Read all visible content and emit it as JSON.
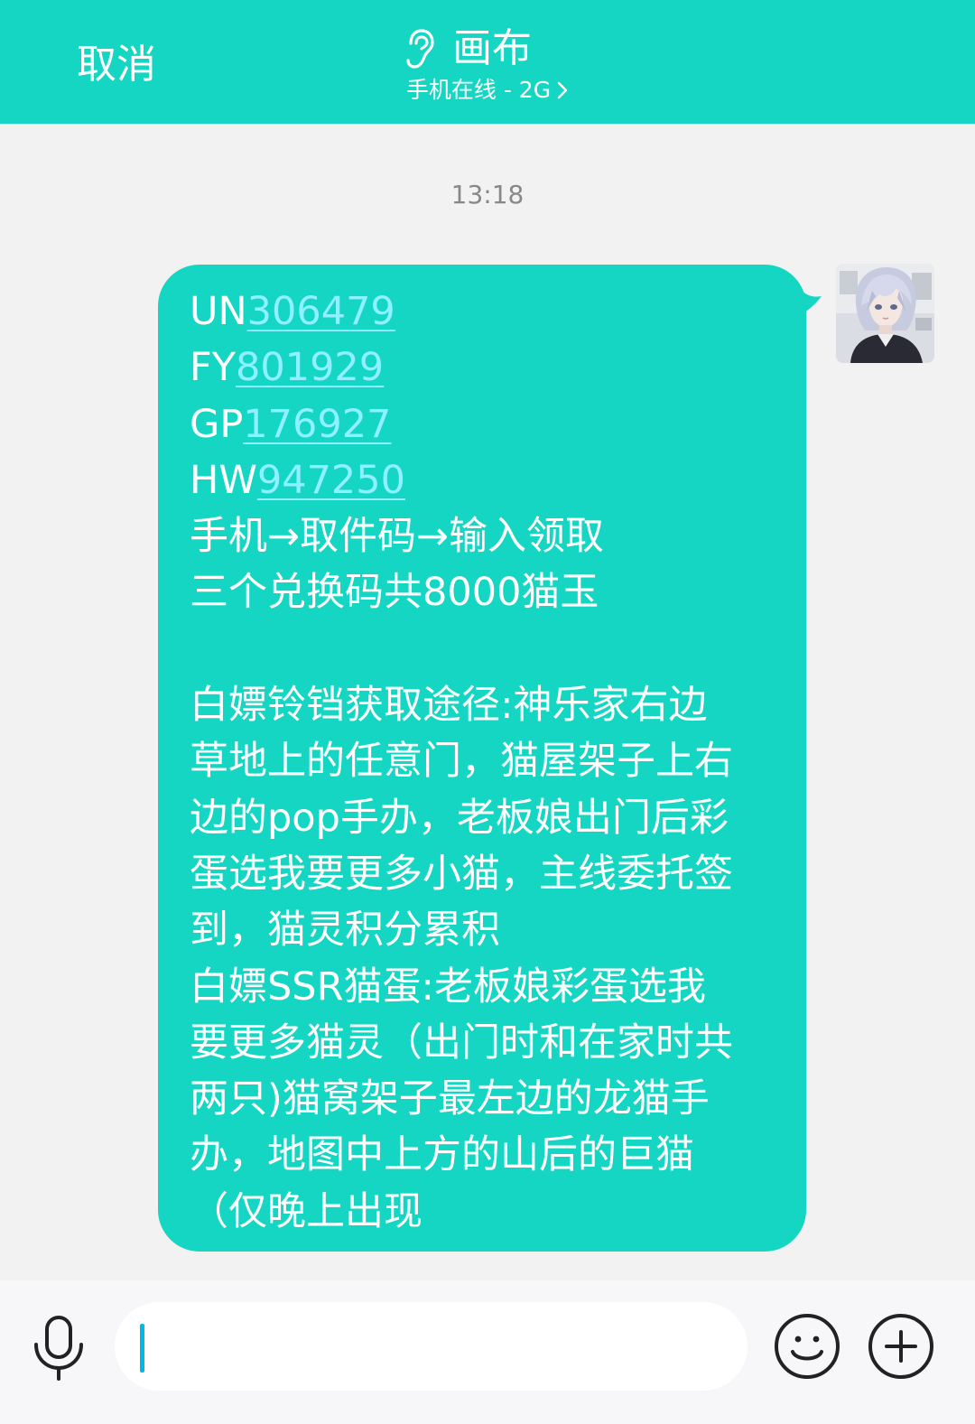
{
  "header": {
    "cancel_label": "取消",
    "title": "画布",
    "subtitle": "手机在线 - 2G",
    "ear_icon": "ear-icon",
    "chevron_icon": "chevron-right-icon",
    "background_color": "#14d6c3"
  },
  "chat": {
    "timestamp": "13:18",
    "message": {
      "codes": [
        {
          "prefix": "UN",
          "code": "306479"
        },
        {
          "prefix": "FY",
          "code": "801929"
        },
        {
          "prefix": "GP",
          "code": "176927"
        },
        {
          "prefix": "HW",
          "code": "947250"
        }
      ],
      "lines": [
        "手机→取件码→输入领取",
        "三个兑换码共8000猫玉",
        "",
        "白嫖铃铛获取途径:神乐家右边",
        "草地上的任意门，猫屋架子上右",
        "边的pop手办，老板娘出门后彩",
        "蛋选我要更多小猫，主线委托签",
        "到，猫灵积分累积",
        "白嫖SSR猫蛋:老板娘彩蛋选我",
        "要更多猫灵（出门时和在家时共",
        "两只)猫窝架子最左边的龙猫手",
        "办，地图中上方的山后的巨猫",
        "（仅晚上出现"
      ],
      "bubble_color": "#14d6c3",
      "link_color": "#8ff0ff"
    },
    "avatar_icon": "avatar"
  },
  "input_bar": {
    "mic_icon": "microphone-icon",
    "input_value": "",
    "emoji_icon": "emoji-icon",
    "plus_icon": "plus-icon"
  }
}
